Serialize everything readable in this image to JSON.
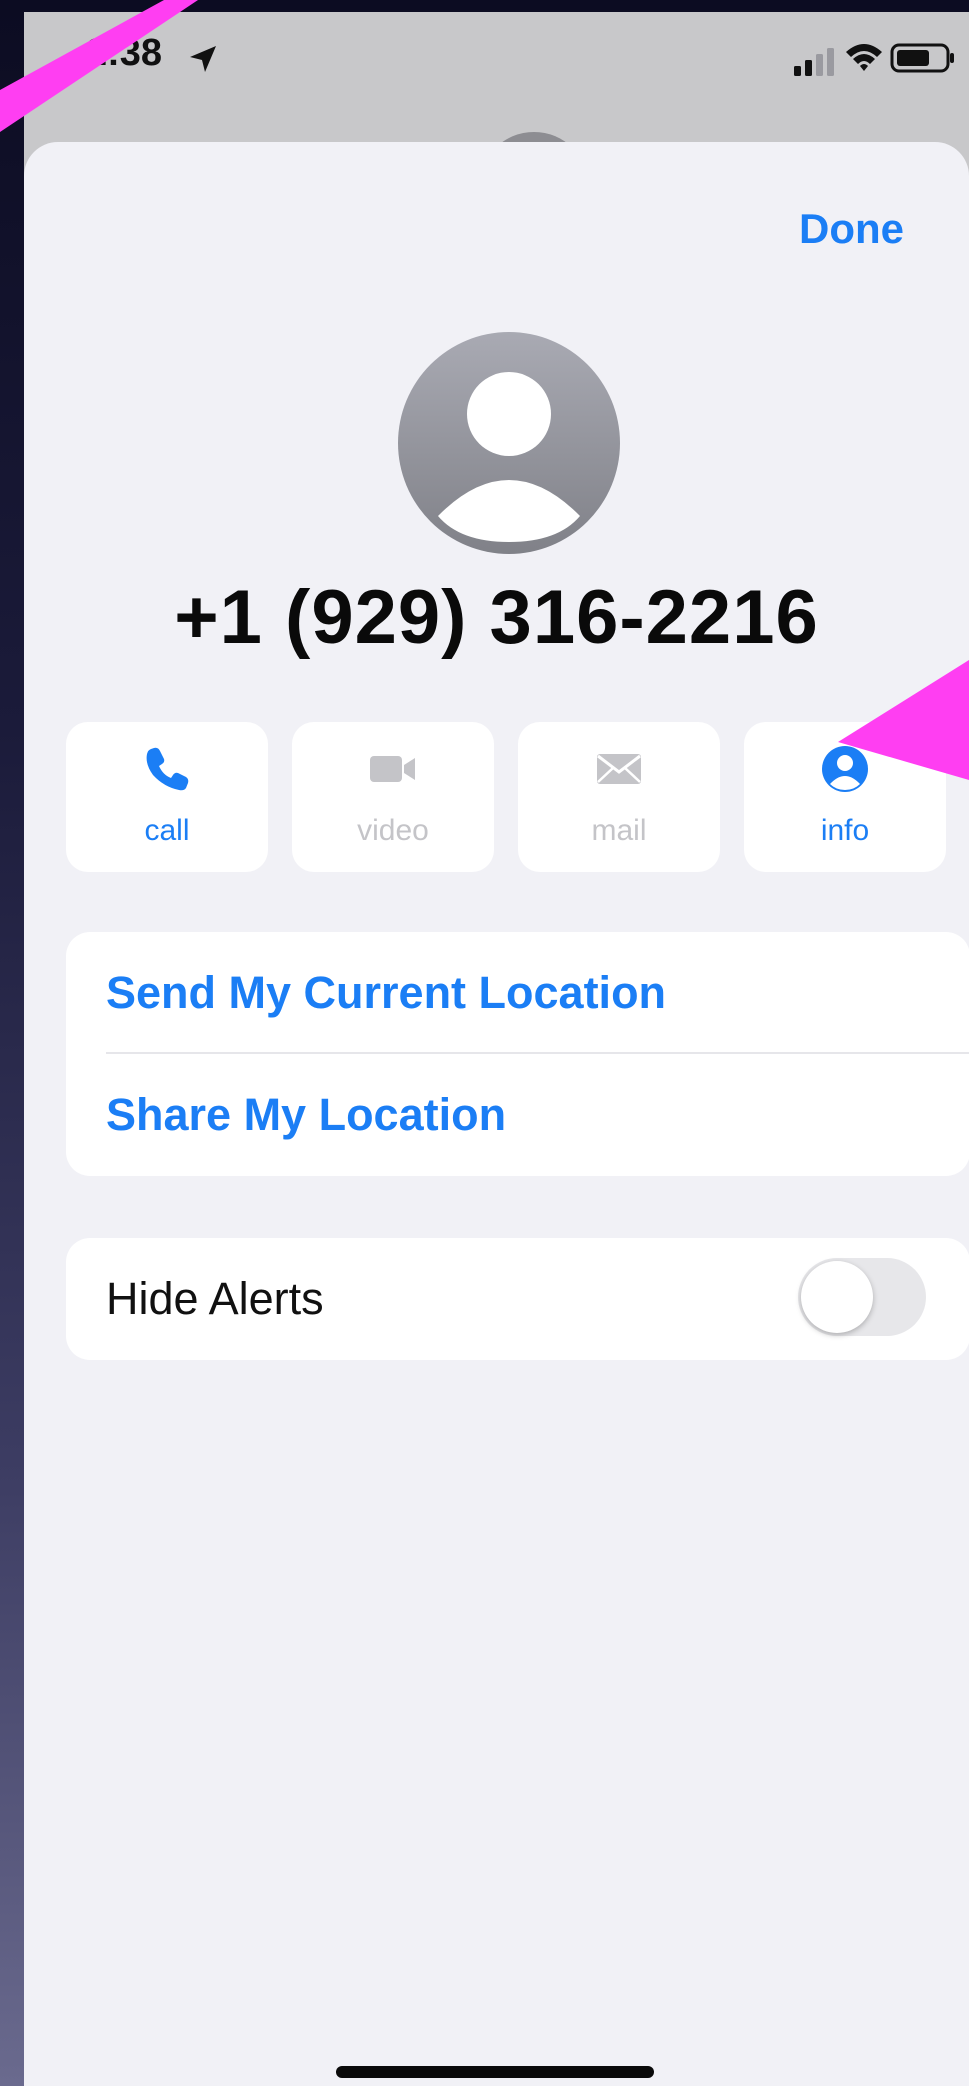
{
  "status_bar": {
    "time": "2:38",
    "icons": [
      "location-arrow-icon",
      "signal-icon",
      "wifi-icon",
      "battery-icon"
    ]
  },
  "sheet": {
    "done_label": "Done"
  },
  "contact": {
    "name": "+1 (929) 316-2216",
    "avatar_icon": "person-placeholder-icon"
  },
  "actions": [
    {
      "label": "call",
      "icon": "phone-icon",
      "enabled": true
    },
    {
      "label": "video",
      "icon": "video-camera-icon",
      "enabled": false
    },
    {
      "label": "mail",
      "icon": "envelope-icon",
      "enabled": false
    },
    {
      "label": "info",
      "icon": "person-circle-icon",
      "enabled": true
    }
  ],
  "location": {
    "send_current": "Send My Current Location",
    "share": "Share My Location"
  },
  "alerts": {
    "hide_alerts_label": "Hide Alerts",
    "hide_alerts_on": false
  },
  "colors": {
    "accent": "#1b7ef5",
    "disabled": "#c4c4c8",
    "annotation": "#ff3ef2",
    "sheet_background": "#f1f1f6"
  }
}
